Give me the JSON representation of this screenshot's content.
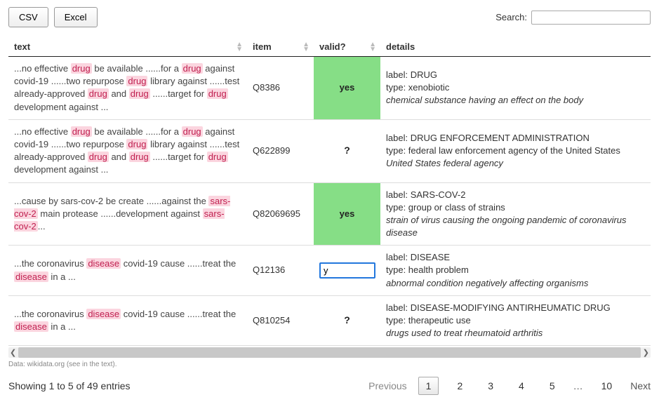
{
  "toolbar": {
    "csv_label": "CSV",
    "excel_label": "Excel",
    "search_label": "Search:",
    "search_value": ""
  },
  "columns": {
    "text": "text",
    "item": "item",
    "valid": "valid?",
    "details": "details"
  },
  "rows": [
    {
      "text_segments": [
        [
          "...no effective ",
          false
        ],
        [
          "drug",
          true
        ],
        [
          " be available ......for a ",
          false
        ],
        [
          "drug",
          true
        ],
        [
          " against covid-19 ......two repurpose ",
          false
        ],
        [
          "drug",
          true
        ],
        [
          " library against ......test already-approved ",
          false
        ],
        [
          "drug",
          true
        ],
        [
          " and ",
          false
        ],
        [
          "drug",
          true
        ],
        [
          " ......target for ",
          false
        ],
        [
          "drug",
          true
        ],
        [
          " development against ...",
          false
        ]
      ],
      "item": "Q8386",
      "valid": "yes",
      "valid_kind": "yes",
      "details": {
        "label": "DRUG",
        "type": "xenobiotic",
        "desc": "chemical substance having an effect on the body"
      }
    },
    {
      "text_segments": [
        [
          "...no effective ",
          false
        ],
        [
          "drug",
          true
        ],
        [
          " be available ......for a ",
          false
        ],
        [
          "drug",
          true
        ],
        [
          " against covid-19 ......two repurpose ",
          false
        ],
        [
          "drug",
          true
        ],
        [
          " library against ......test already-approved ",
          false
        ],
        [
          "drug",
          true
        ],
        [
          " and ",
          false
        ],
        [
          "drug",
          true
        ],
        [
          " ......target for ",
          false
        ],
        [
          "drug",
          true
        ],
        [
          " development against ...",
          false
        ]
      ],
      "item": "Q622899",
      "valid": "?",
      "valid_kind": "q",
      "details": {
        "label": "DRUG ENFORCEMENT ADMINISTRATION",
        "type": "federal law enforcement agency of the United States",
        "desc": "United States federal agency"
      }
    },
    {
      "text_segments": [
        [
          "...cause by sars-cov-2 be create ......against the ",
          false
        ],
        [
          "sars-cov-2",
          true
        ],
        [
          " main protease ......development against ",
          false
        ],
        [
          "sars-cov-2",
          true
        ],
        [
          "...",
          false
        ]
      ],
      "item": "Q82069695",
      "valid": "yes",
      "valid_kind": "yes",
      "details": {
        "label": "SARS-COV-2",
        "type": "group or class of strains",
        "desc": "strain of virus causing the ongoing pandemic of coronavirus disease"
      }
    },
    {
      "text_segments": [
        [
          "...the coronavirus ",
          false
        ],
        [
          "disease",
          true
        ],
        [
          " covid-19 cause ......treat the ",
          false
        ],
        [
          "disease",
          true
        ],
        [
          " in a ...",
          false
        ]
      ],
      "item": "Q12136",
      "valid": "y",
      "valid_kind": "input",
      "details": {
        "label": "DISEASE",
        "type": "health problem",
        "desc": "abnormal condition negatively affecting organisms"
      }
    },
    {
      "text_segments": [
        [
          "...the coronavirus ",
          false
        ],
        [
          "disease",
          true
        ],
        [
          " covid-19 cause ......treat the ",
          false
        ],
        [
          "disease",
          true
        ],
        [
          " in a ...",
          false
        ]
      ],
      "item": "Q810254",
      "valid": "?",
      "valid_kind": "q",
      "details": {
        "label": "DISEASE-MODIFYING ANTIRHEUMATIC DRUG",
        "type": "therapeutic use",
        "desc": "drugs used to treat rheumatoid arthritis"
      }
    }
  ],
  "data_source": "Data: wikidata.org (see in the text).",
  "info": "Showing 1 to 5 of 49 entries",
  "pager": {
    "prev": "Previous",
    "next": "Next",
    "pages": [
      "1",
      "2",
      "3",
      "4",
      "5"
    ],
    "ellipsis": "…",
    "last_page": "10",
    "current": "1"
  },
  "labels": {
    "label_prefix": "label: ",
    "type_prefix": "type: "
  }
}
